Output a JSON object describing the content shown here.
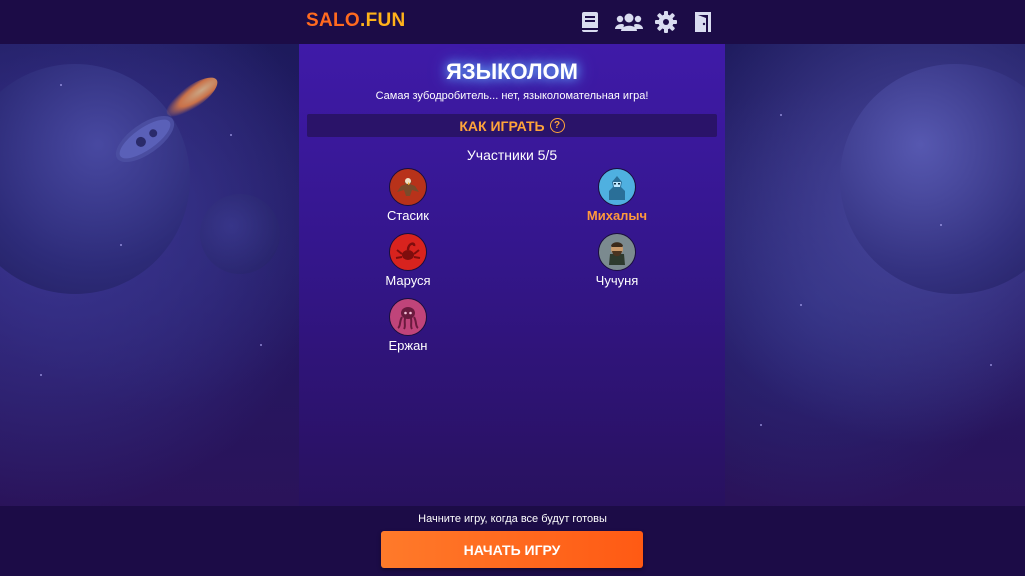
{
  "header": {
    "logo_part1": "SALO",
    "logo_part2": ".FUN",
    "icons": [
      "rules-book-icon",
      "friends-icon",
      "settings-gear-icon",
      "exit-door-icon"
    ]
  },
  "game": {
    "title": "ЯЗЫКОЛОМ",
    "subtitle": "Самая зубодробитель... нет, языколомательная игра!",
    "how_to_play": "КАК ИГРАТЬ",
    "help_glyph": "?",
    "participants_label": "Участники 5/5"
  },
  "players": [
    {
      "name": "Стасик",
      "avatar": "eagle-avatar-icon",
      "color": "#b8321a",
      "current": false
    },
    {
      "name": "Михалыч",
      "avatar": "ice-knight-avatar-icon",
      "color": "#4fb0e0",
      "current": true
    },
    {
      "name": "Маруся",
      "avatar": "red-scorpion-avatar-icon",
      "color": "#d8231e",
      "current": false
    },
    {
      "name": "Чучуня",
      "avatar": "bearded-warrior-avatar-icon",
      "color": "#7b8a8f",
      "current": false
    },
    {
      "name": "Ержан",
      "avatar": "octopus-avatar-icon",
      "color": "#c0447a",
      "current": false
    }
  ],
  "footer": {
    "hint": "Начните игру, когда все будут готовы",
    "start_button": "НАЧАТЬ ИГРУ"
  },
  "colors": {
    "accent_orange": "#ff6a1f",
    "logo_yellow": "#ffb21a",
    "panel_purple": "#3f1aa8",
    "header_bg": "#1c0c47"
  }
}
